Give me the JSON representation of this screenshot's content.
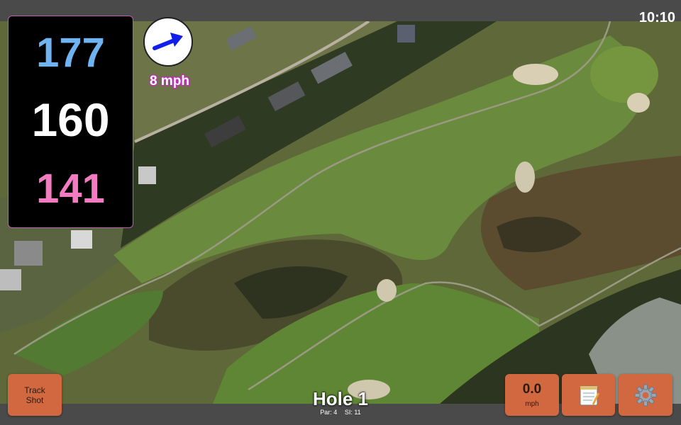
{
  "status": {
    "clock": "10:10"
  },
  "distances": {
    "back": "177",
    "middle": "160",
    "front": "141"
  },
  "wind": {
    "speed_label": "8 mph",
    "icon": "wind-direction-arrow-icon"
  },
  "buttons": {
    "track_shot_line1": "Track",
    "track_shot_line2": "Shot",
    "speed_value": "0.0",
    "speed_unit": "mph",
    "notes_icon": "notepad-icon",
    "settings_icon": "gear-icon"
  },
  "hole": {
    "title": "Hole 1",
    "par": "Par: 4",
    "si": "SI: 11"
  },
  "colors": {
    "back_distance": "#6fb3f0",
    "middle_distance": "#ffffff",
    "front_distance": "#f27bc1",
    "button_bg": "#d2683f",
    "wind_arrow": "#1020e8"
  }
}
